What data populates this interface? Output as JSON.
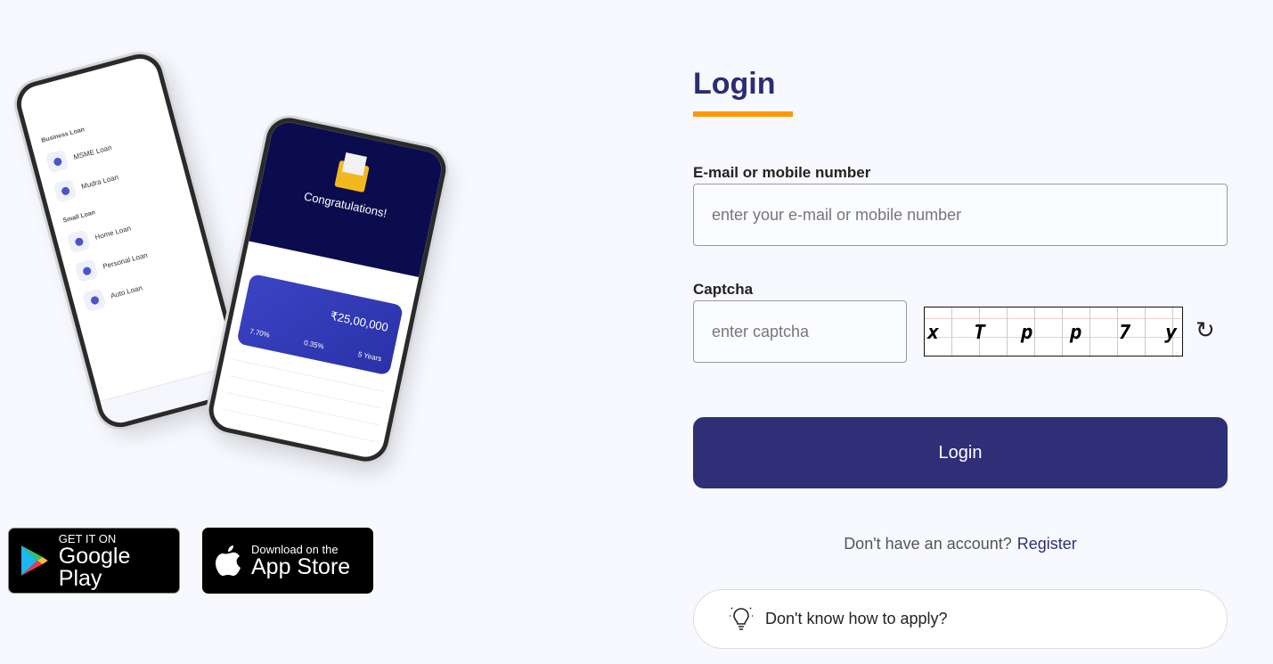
{
  "illustration": {
    "phone1": {
      "sections": [
        "Business Loan",
        "Small Loan"
      ],
      "items_business": [
        "MSME Loan",
        "Mudra Loan"
      ],
      "items_small": [
        "Home Loan",
        "Personal Loan",
        "Auto Loan"
      ]
    },
    "phone2": {
      "heading": "Congratulations!",
      "amount": "₹25,00,000",
      "stats": [
        "7.70%",
        "0.35%",
        "5 Years"
      ]
    }
  },
  "stores": {
    "google": {
      "small": "GET IT ON",
      "large": "Google Play"
    },
    "apple": {
      "small": "Download on the",
      "large": "App Store"
    }
  },
  "login": {
    "title": "Login",
    "accent_color": "#ff9800",
    "primary_color": "#2e2f77",
    "email_label": "E-mail or mobile number",
    "email_placeholder": "enter your e-mail or mobile number",
    "email_value": "",
    "captcha_label": "Captcha",
    "captcha_placeholder": "enter captcha",
    "captcha_value": "",
    "captcha_chars": [
      "x",
      "T",
      "p",
      "p",
      "7",
      "y"
    ],
    "refresh_icon": "refresh-icon",
    "submit_label": "Login",
    "no_account_text": "Don't have an account?",
    "register_label": "Register",
    "help_label": "Don't know how to apply?",
    "help_icon": "lightbulb-icon"
  }
}
